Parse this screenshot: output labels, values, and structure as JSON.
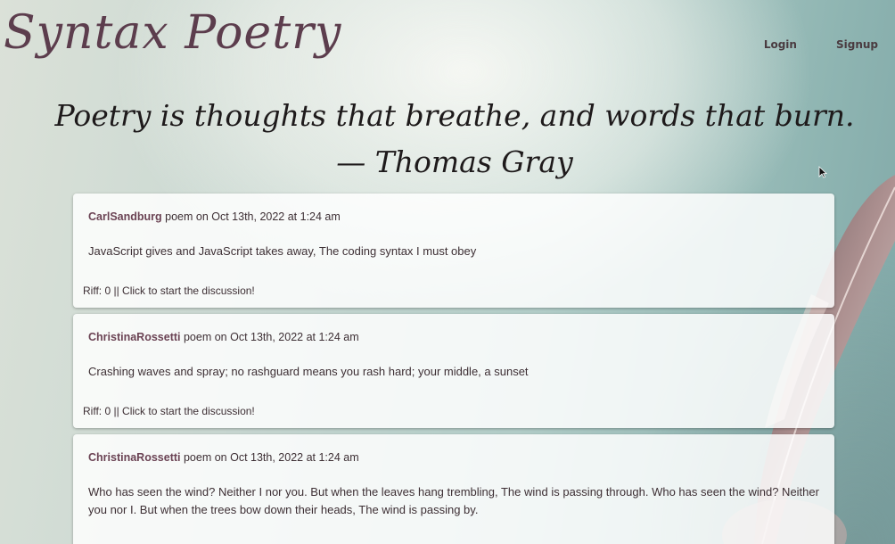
{
  "app": {
    "title": "Syntax Poetry"
  },
  "nav": {
    "login": "Login",
    "signup": "Signup"
  },
  "hero": {
    "quote": "Poetry is thoughts that breathe, and words that burn. — Thomas Gray"
  },
  "posts": [
    {
      "author": "CarlSandburg",
      "meta": "poem on Oct 13th, 2022 at 1:24 am",
      "body": "JavaScript gives and JavaScript takes away, The coding syntax I must obey",
      "riff": "Riff: 0 || Click to start the discussion!"
    },
    {
      "author": "ChristinaRossetti",
      "meta": "poem on Oct 13th, 2022 at 1:24 am",
      "body": "Crashing waves and spray; no rashguard means you rash hard; your middle, a sunset",
      "riff": "Riff: 0 || Click to start the discussion!"
    },
    {
      "author": "ChristinaRossetti",
      "meta": "poem on Oct 13th, 2022 at 1:24 am",
      "body": "Who has seen the wind? Neither I nor you. But when the leaves hang trembling, The wind is passing through. Who has seen the wind? Neither you nor I. But when the trees bow down their heads, The wind is passing by."
    }
  ]
}
